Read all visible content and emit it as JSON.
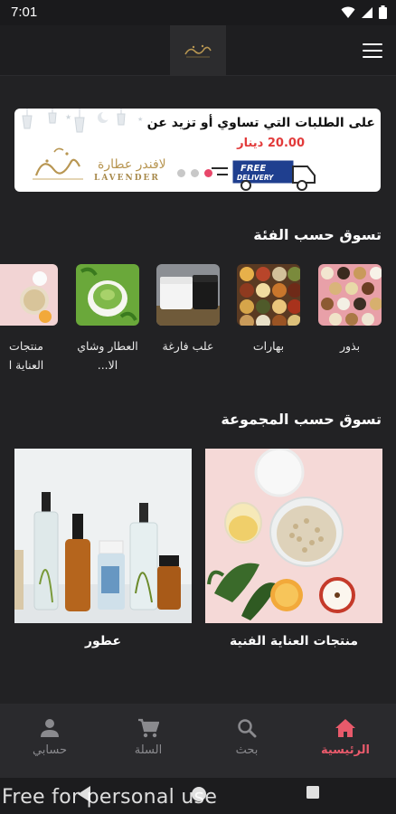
{
  "status_bar": {
    "time": "7:01"
  },
  "banner": {
    "line1": "على الطلبات التي تساوي أو تزيد عن",
    "amount": "20.00 دينار",
    "brand_sub": "LAVENDER",
    "brand_ar": "لافندر عطارة",
    "truck_text_1": "FREE",
    "truck_text_2": "DELIVERY",
    "slides": 3,
    "active_slide": 1
  },
  "sections": {
    "categories_title": "تسوق حسب الفئة",
    "collections_title": "تسوق حسب المجموعة"
  },
  "categories": [
    {
      "label": "بذور"
    },
    {
      "label": "بهارات"
    },
    {
      "label": "علب فارغة"
    },
    {
      "label": "العطار وشاي الا..."
    },
    {
      "label": "منتجات العناية ا"
    }
  ],
  "collections": [
    {
      "label": "منتجات العناية الفنية"
    },
    {
      "label": "عطور"
    }
  ],
  "bottom_nav": {
    "home": "الرئيسية",
    "search": "بحث",
    "cart": "السلة",
    "account": "حسابي"
  },
  "watermark": "Free for personal use",
  "colors": {
    "background": "#222224",
    "accent": "#e85a6b",
    "nav_inactive": "#8a8a8e"
  }
}
